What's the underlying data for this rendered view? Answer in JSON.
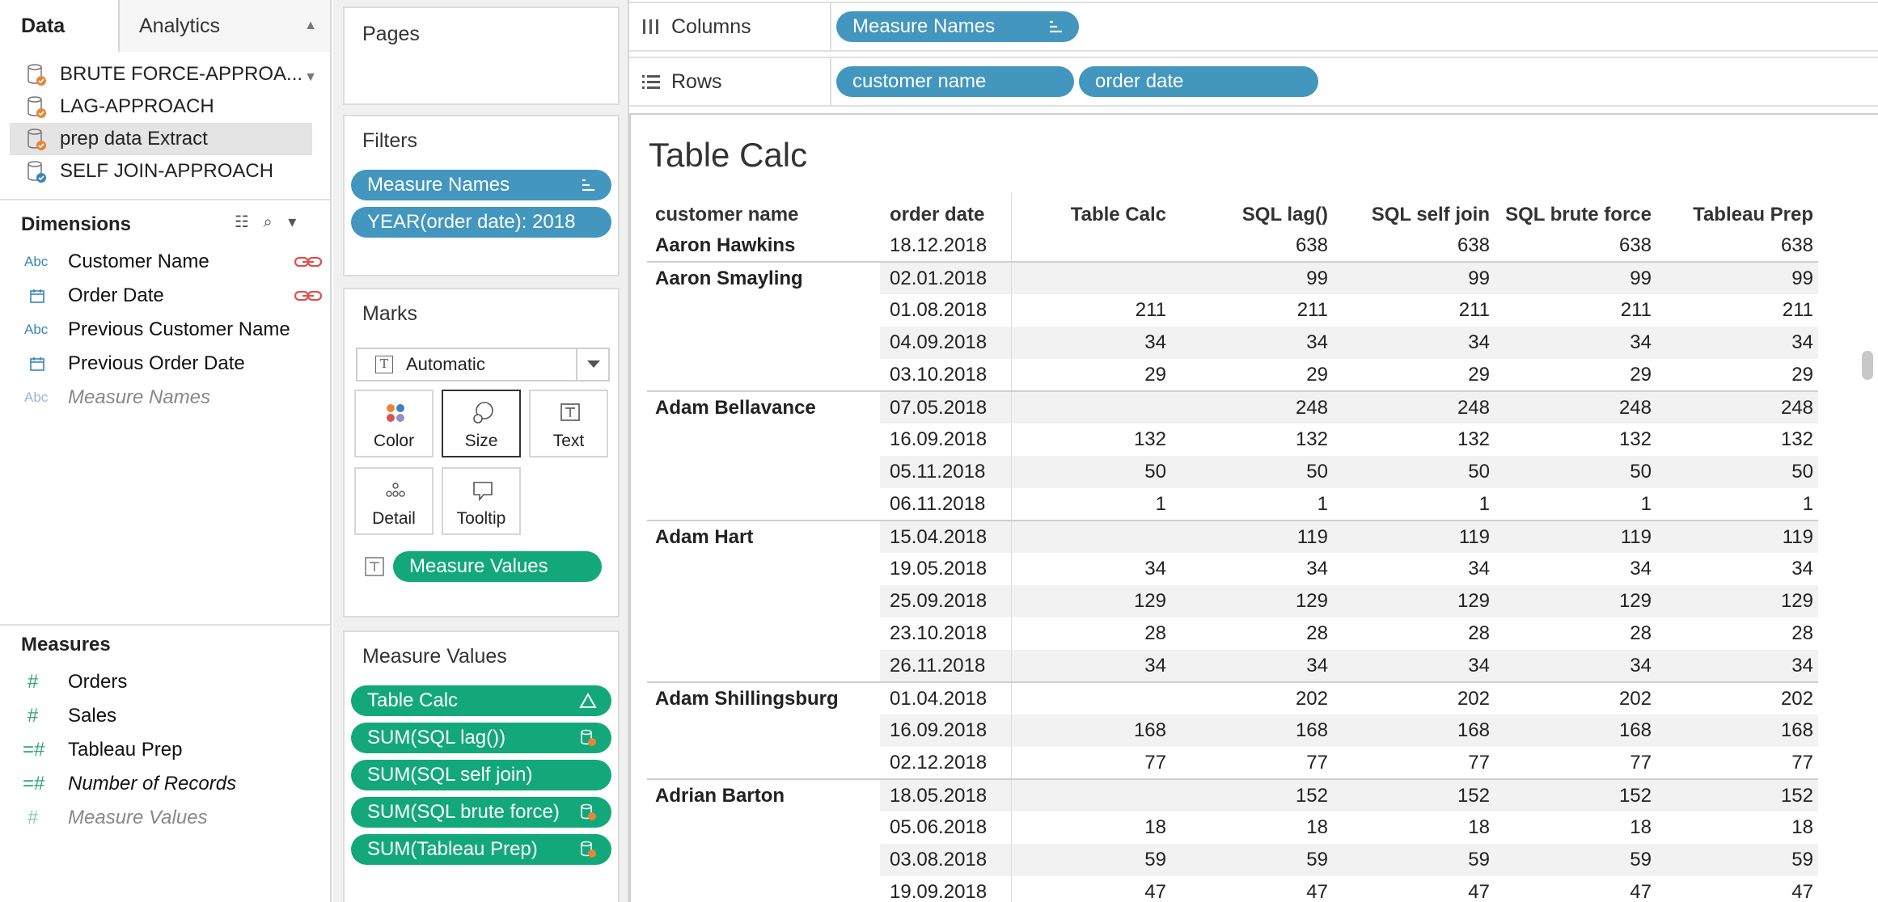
{
  "data_pane": {
    "tabs": [
      "Data",
      "Analytics"
    ],
    "datasources": [
      {
        "label": "BRUTE FORCE-APPROA...",
        "selected": false
      },
      {
        "label": "LAG-APPROACH",
        "selected": false
      },
      {
        "label": "prep data Extract",
        "selected": true
      },
      {
        "label": "SELF JOIN-APPROACH",
        "selected": false
      }
    ],
    "dimensions_title": "Dimensions",
    "dimensions": [
      {
        "label": "Customer Name",
        "type": "Abc"
      },
      {
        "label": "Order Date",
        "type": "date"
      },
      {
        "label": "Previous Customer Name",
        "type": "Abc"
      },
      {
        "label": "Previous Order Date",
        "type": "date"
      },
      {
        "label": "Measure Names",
        "type": "Abc"
      }
    ],
    "measures_title": "Measures",
    "measures": [
      {
        "label": "Orders"
      },
      {
        "label": "Sales"
      },
      {
        "label": "Tableau Prep"
      },
      {
        "label": "Number of Records"
      },
      {
        "label": "Measure Values"
      }
    ]
  },
  "cards": {
    "pages_title": "Pages",
    "filters_title": "Filters",
    "filters": [
      "Measure Names",
      "YEAR(order date): 2018"
    ],
    "marks_title": "Marks",
    "marks_type": "Automatic",
    "marks_buttons": [
      "Color",
      "Size",
      "Text",
      "Detail",
      "Tooltip"
    ],
    "marks_text_pill": "Measure Values",
    "measure_values_title": "Measure Values",
    "measure_values": [
      "Table Calc",
      "SUM(SQL lag())",
      "SUM(SQL self join)",
      "SUM(SQL brute force)",
      "SUM(Tableau Prep)"
    ]
  },
  "shelves": {
    "columns_label": "Columns",
    "columns_pills": [
      "Measure Names"
    ],
    "rows_label": "Rows",
    "rows_pills": [
      "customer name",
      "order date"
    ]
  },
  "view": {
    "title": "Table Calc",
    "headers": [
      "customer name",
      "order date",
      "Table Calc",
      "SQL lag()",
      "SQL self join",
      "SQL brute force",
      "Tableau Prep"
    ],
    "groups": [
      {
        "customer": "Aaron Hawkins",
        "rows": [
          [
            "18.12.2018",
            "",
            "638",
            "638",
            "638",
            "638"
          ]
        ]
      },
      {
        "customer": "Aaron Smayling",
        "rows": [
          [
            "02.01.2018",
            "",
            "99",
            "99",
            "99",
            "99"
          ],
          [
            "01.08.2018",
            "211",
            "211",
            "211",
            "211",
            "211"
          ],
          [
            "04.09.2018",
            "34",
            "34",
            "34",
            "34",
            "34"
          ],
          [
            "03.10.2018",
            "29",
            "29",
            "29",
            "29",
            "29"
          ]
        ]
      },
      {
        "customer": "Adam Bellavance",
        "rows": [
          [
            "07.05.2018",
            "",
            "248",
            "248",
            "248",
            "248"
          ],
          [
            "16.09.2018",
            "132",
            "132",
            "132",
            "132",
            "132"
          ],
          [
            "05.11.2018",
            "50",
            "50",
            "50",
            "50",
            "50"
          ],
          [
            "06.11.2018",
            "1",
            "1",
            "1",
            "1",
            "1"
          ]
        ]
      },
      {
        "customer": "Adam Hart",
        "rows": [
          [
            "15.04.2018",
            "",
            "119",
            "119",
            "119",
            "119"
          ],
          [
            "19.05.2018",
            "34",
            "34",
            "34",
            "34",
            "34"
          ],
          [
            "25.09.2018",
            "129",
            "129",
            "129",
            "129",
            "129"
          ],
          [
            "23.10.2018",
            "28",
            "28",
            "28",
            "28",
            "28"
          ],
          [
            "26.11.2018",
            "34",
            "34",
            "34",
            "34",
            "34"
          ]
        ]
      },
      {
        "customer": "Adam Shillingsburg",
        "rows": [
          [
            "01.04.2018",
            "",
            "202",
            "202",
            "202",
            "202"
          ],
          [
            "16.09.2018",
            "168",
            "168",
            "168",
            "168",
            "168"
          ],
          [
            "02.12.2018",
            "77",
            "77",
            "77",
            "77",
            "77"
          ]
        ]
      },
      {
        "customer": "Adrian Barton",
        "rows": [
          [
            "18.05.2018",
            "",
            "152",
            "152",
            "152",
            "152"
          ],
          [
            "05.06.2018",
            "18",
            "18",
            "18",
            "18",
            "18"
          ],
          [
            "03.08.2018",
            "59",
            "59",
            "59",
            "59",
            "59"
          ],
          [
            "19.09.2018",
            "47",
            "47",
            "47",
            "47",
            "47"
          ]
        ]
      }
    ]
  },
  "colors": {
    "blue_pill": "#4396be",
    "green_pill": "#13a87a",
    "link_red": "#d9534f"
  }
}
